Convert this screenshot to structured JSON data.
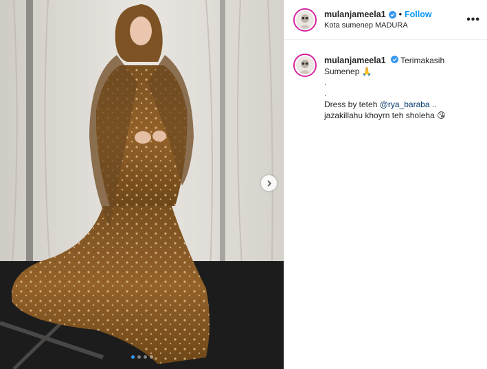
{
  "post": {
    "username": "mulanjameela1",
    "verified": true,
    "separator": "•",
    "follow_label": "Follow",
    "location": "Kota sumenep MADURA",
    "more_label": "•••",
    "carousel": {
      "slide_count": 4,
      "active_index": 0
    }
  },
  "caption": {
    "username": "mulanjameela1",
    "verified": true,
    "line1": "Terimakasih",
    "line2": "Sumenep 🙏",
    "dot1": ".",
    "dot2": ".",
    "line3_prefix": "Dress by teteh ",
    "mention": "@rya_baraba",
    "line3_suffix": " ..",
    "line4": "jazakillahu khoyrn teh sholeha 😘"
  },
  "icons": {
    "verified": "verified-badge-icon",
    "next": "chevron-right-icon",
    "more": "more-options-icon"
  },
  "colors": {
    "accent": "#0095f6",
    "verified": "#3897f0",
    "dress": "#8a5a1e"
  }
}
